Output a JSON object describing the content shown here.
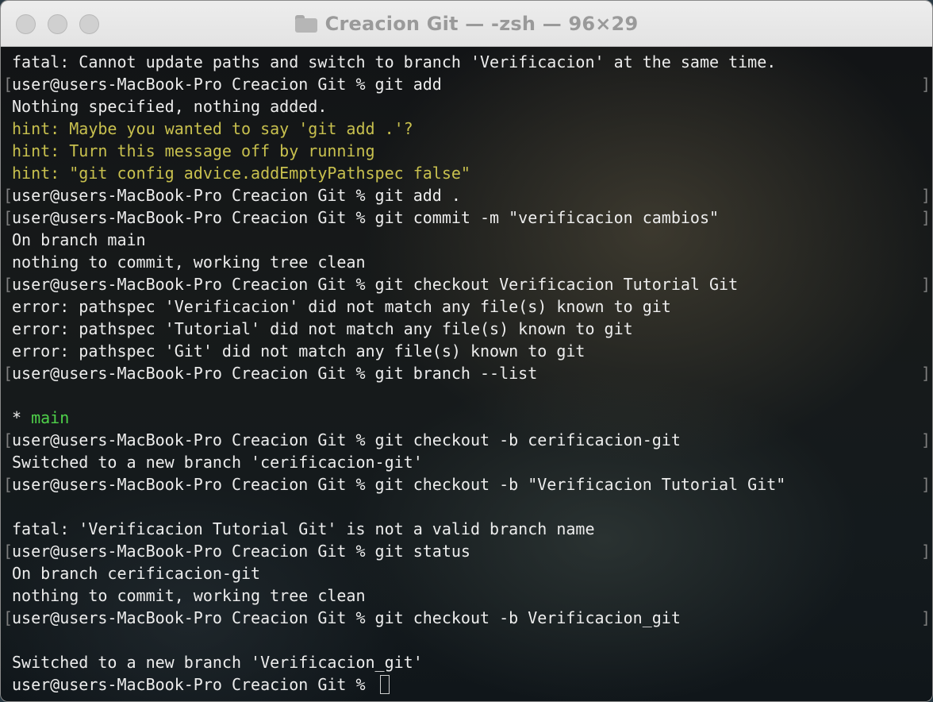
{
  "window": {
    "title": "Creacion Git — -zsh — 96×29",
    "folder_icon": "folder-icon"
  },
  "colors": {
    "hint": "#c8c04e",
    "branch_highlight": "#4fd14a",
    "text": "#ededed"
  },
  "terminal": {
    "lines": [
      {
        "text": "fatal: Cannot update paths and switch to branch 'Verificacion' at the same time.",
        "kind": "output"
      },
      {
        "text": "user@users-MacBook-Pro Creacion Git % git add",
        "kind": "prompt"
      },
      {
        "text": "Nothing specified, nothing added.",
        "kind": "output"
      },
      {
        "text": "hint: Maybe you wanted to say 'git add .'?",
        "kind": "hint"
      },
      {
        "text": "hint: Turn this message off by running",
        "kind": "hint"
      },
      {
        "text": "hint: \"git config advice.addEmptyPathspec false\"",
        "kind": "hint"
      },
      {
        "text": "user@users-MacBook-Pro Creacion Git % git add .",
        "kind": "prompt"
      },
      {
        "text": "user@users-MacBook-Pro Creacion Git % git commit -m \"verificacion cambios\"",
        "kind": "prompt"
      },
      {
        "text": "On branch main",
        "kind": "output"
      },
      {
        "text": "nothing to commit, working tree clean",
        "kind": "output"
      },
      {
        "text": "user@users-MacBook-Pro Creacion Git % git checkout Verificacion Tutorial Git",
        "kind": "prompt"
      },
      {
        "text": "error: pathspec 'Verificacion' did not match any file(s) known to git",
        "kind": "output"
      },
      {
        "text": "error: pathspec 'Tutorial' did not match any file(s) known to git",
        "kind": "output"
      },
      {
        "text": "error: pathspec 'Git' did not match any file(s) known to git",
        "kind": "output"
      },
      {
        "text": "user@users-MacBook-Pro Creacion Git % git branch --list",
        "kind": "prompt"
      },
      {
        "text": "",
        "kind": "blank"
      },
      {
        "text": "* ",
        "branch": "main",
        "kind": "branch"
      },
      {
        "text": "user@users-MacBook-Pro Creacion Git % git checkout -b cerificacion-git",
        "kind": "prompt"
      },
      {
        "text": "Switched to a new branch 'cerificacion-git'",
        "kind": "output"
      },
      {
        "text": "user@users-MacBook-Pro Creacion Git % git checkout -b \"Verificacion Tutorial Git\"",
        "kind": "prompt"
      },
      {
        "text": "",
        "kind": "blank"
      },
      {
        "text": "fatal: 'Verificacion Tutorial Git' is not a valid branch name",
        "kind": "output"
      },
      {
        "text": "user@users-MacBook-Pro Creacion Git % git status",
        "kind": "prompt"
      },
      {
        "text": "On branch cerificacion-git",
        "kind": "output"
      },
      {
        "text": "nothing to commit, working tree clean",
        "kind": "output"
      },
      {
        "text": "user@users-MacBook-Pro Creacion Git % git checkout -b Verificacion_git",
        "kind": "prompt"
      },
      {
        "text": "",
        "kind": "blank"
      },
      {
        "text": "Switched to a new branch 'Verificacion_git'",
        "kind": "output"
      },
      {
        "text": "user@users-MacBook-Pro Creacion Git % ",
        "kind": "current"
      }
    ],
    "mark_left": "[",
    "mark_right": "]"
  }
}
